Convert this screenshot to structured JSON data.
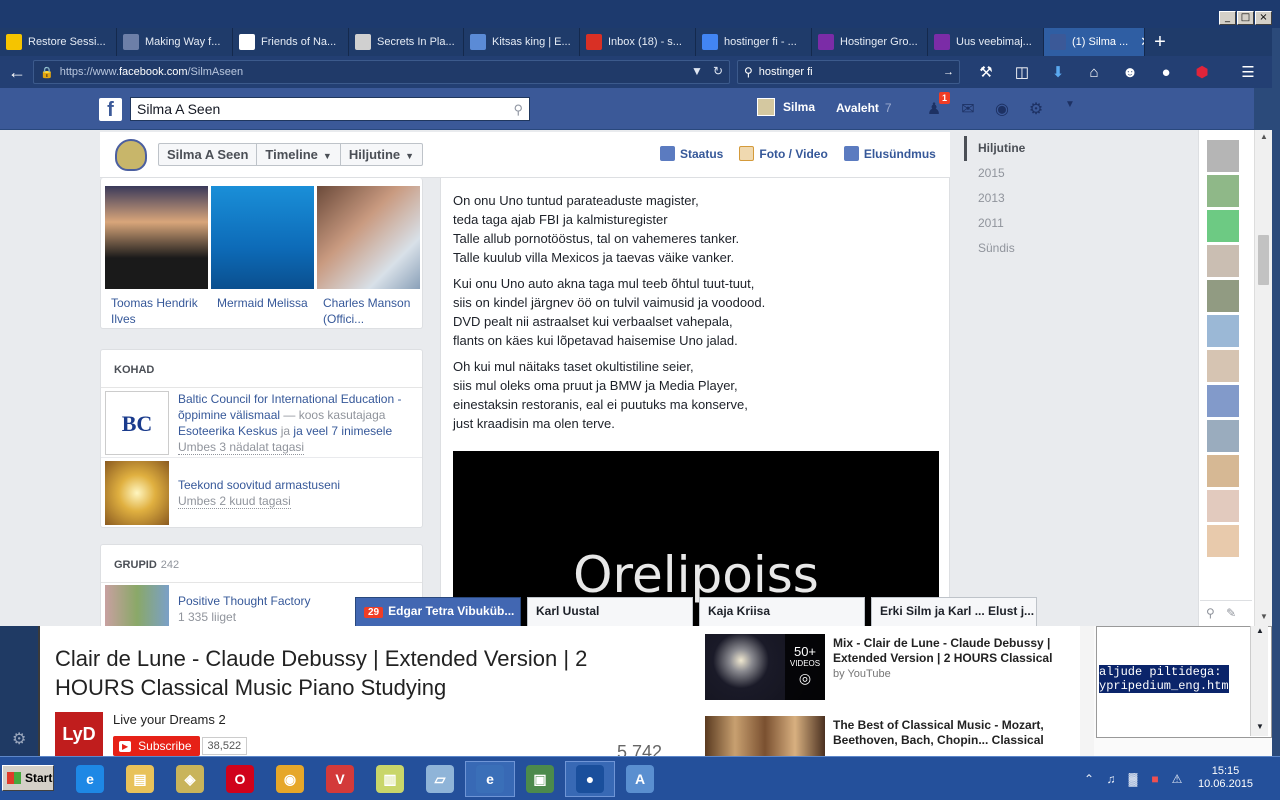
{
  "window": {
    "buttons": [
      "_",
      "□",
      "×"
    ]
  },
  "tabs": [
    {
      "label": "Restore Sessi...",
      "icon": "warning-icon",
      "color": "#f5c400"
    },
    {
      "label": "Making Way f...",
      "icon": "y-icon",
      "color": "#6d7fa8"
    },
    {
      "label": "Friends of Na...",
      "icon": "wikipedia-icon",
      "color": "#ffffff"
    },
    {
      "label": "Secrets In Pla...",
      "icon": "eye-icon",
      "color": "#d0d0d0"
    },
    {
      "label": "Kitsas king | E...",
      "icon": "arrow-icon",
      "color": "#5b8bd6"
    },
    {
      "label": "Inbox (18) - s...",
      "icon": "gmail-icon",
      "color": "#d93025"
    },
    {
      "label": "hostinger fi - ...",
      "icon": "google-icon",
      "color": "#4285f4"
    },
    {
      "label": "Hostinger Gro...",
      "icon": "hostinger-icon",
      "color": "#7b2ca7"
    },
    {
      "label": "Uus veebimaj...",
      "icon": "hostinger-icon",
      "color": "#7b2ca7"
    },
    {
      "label": "(1) Silma ...",
      "icon": "facebook-icon",
      "color": "#3b5998",
      "active": true
    }
  ],
  "nav": {
    "url_prefix": "https://www.",
    "url_host": "facebook.com",
    "url_path": "/SilmAseen",
    "search_value": "hostinger fi"
  },
  "fb": {
    "logo": "f",
    "search_value": "Silma A Seen",
    "user_name": "Silma",
    "home_label": "Avaleht",
    "home_count": "7",
    "friend_badge": "1"
  },
  "timeline_nav": {
    "name": "Silma A Seen",
    "timeline": "Timeline",
    "recent": "Hiljutine",
    "status": "Staatus",
    "photo": "Foto / Video",
    "life_event": "Elusündmus"
  },
  "photos": [
    {
      "label": "Toomas Hendrik Ilves"
    },
    {
      "label": "Mermaid Melissa"
    },
    {
      "label": "Charles Manson (Offici..."
    }
  ],
  "places": {
    "header": "KOHAD",
    "items": [
      {
        "title": "Baltic Council for International Education - õppimine välismaal",
        "with_text": " — koos kasutajaga ",
        "with_link": "Esoteerika Keskus",
        "and_text": " ja ",
        "others_link": "ja veel 7 inimesele",
        "ago": "Umbes 3 nädalat tagasi"
      },
      {
        "title": "Teekond soovitud armastuseni",
        "ago": "Umbes 2 kuud tagasi"
      }
    ]
  },
  "groups": {
    "header": "GRUPID",
    "count": "242",
    "items": [
      {
        "title": "Positive Thought Factory",
        "members": "1 335 liiget"
      }
    ]
  },
  "poem": [
    [
      "On onu Uno tuntud parateaduste magister,",
      "teda taga ajab FBI ja kalmisturegister",
      "Talle allub pornotööstus, tal on vahemeres tanker.",
      "Talle kuulub villa Mexicos ja taevas väike vanker."
    ],
    [
      "Kui onu Uno auto akna taga mul teeb õhtul tuut-tuut,",
      "siis on kindel järgnev öö on tulvil vaimusid ja voodood.",
      "DVD pealt nii astraalset kui verbaalset vahepala,",
      "flants on käes kui lõpetavad haisemise Uno jalad."
    ],
    [
      "Oh kui mul näitaks taset okultistiline seier,",
      "siis mul oleks oma pruut ja BMW ja Media Player,",
      "einestaksin restoranis, eal ei puutuks ma konserve,",
      "just kraadisin ma olen terve."
    ]
  ],
  "video_text": "Orelipoiss",
  "years": [
    "Hiljutine",
    "2015",
    "2013",
    "2011",
    "Sündis"
  ],
  "chat_tabs": [
    {
      "label": "Edgar Tetra Vibuküb...",
      "badge": "29"
    },
    {
      "label": "Karl Uustal"
    },
    {
      "label": "Kaja Kriisa"
    },
    {
      "label": "Erki Silm ja Karl ... Elust j..."
    }
  ],
  "youtube": {
    "title": "Clair de Lune - Claude Debussy | Extended Version | 2 HOURS Classical Music Piano Studying",
    "channel_logo": "LyD",
    "channel": "Live your Dreams 2",
    "subscribe": "Subscribe",
    "subscribers": "38,522",
    "views": "5 742",
    "recs": [
      {
        "title": "Mix - Clair de Lune - Claude Debussy | Extended Version | 2 HOURS Classical",
        "by": "by YouTube",
        "count": "50+",
        "count_label": "VIDEOS"
      },
      {
        "title": "The Best of Classical Music - Mozart, Beethoven, Bach, Chopin... Classical",
        "by": ""
      }
    ]
  },
  "note": {
    "selected": "aljude piltidega:\nypripedium_eng.htm"
  },
  "taskbar": {
    "start": "Start",
    "apps": [
      {
        "icon": "internet-explorer-icon",
        "glyph": "e",
        "color": "#1e88e5"
      },
      {
        "icon": "folder-icon",
        "glyph": "▤",
        "color": "#e8c25a"
      },
      {
        "icon": "game-icon",
        "glyph": "◈",
        "color": "#c9b45a"
      },
      {
        "icon": "opera-icon",
        "glyph": "O",
        "color": "#d0021b"
      },
      {
        "icon": "chrome-icon",
        "glyph": "◉",
        "color": "#e6a72a"
      },
      {
        "icon": "vivaldi-icon",
        "glyph": "V",
        "color": "#d33a3a"
      },
      {
        "icon": "notes-icon",
        "glyph": "▥",
        "color": "#c9d66a"
      },
      {
        "icon": "pen-icon",
        "glyph": "▱",
        "color": "#8fb4d8"
      },
      {
        "icon": "elisa-icon",
        "glyph": "e",
        "color": "#3a6fb8",
        "active": true
      },
      {
        "icon": "monitor-icon",
        "glyph": "▣",
        "color": "#4c8a4c"
      },
      {
        "icon": "firefox-icon",
        "glyph": "●",
        "color": "#1a4f9c",
        "active": true
      },
      {
        "icon": "document-icon",
        "glyph": "A",
        "color": "#5a8fd0"
      }
    ],
    "time": "15:15",
    "date": "10.06.2015"
  }
}
